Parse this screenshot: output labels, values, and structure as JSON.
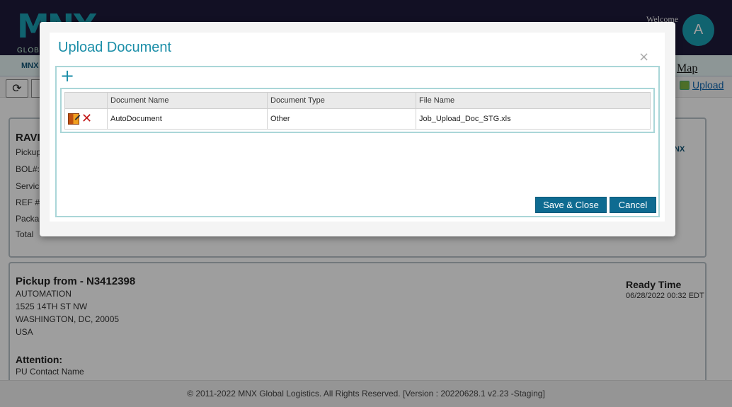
{
  "header": {
    "logo_text": "MNX",
    "logo_sub": "GLOBAL",
    "welcome": "Welcome",
    "avatar_initial": "A"
  },
  "subnav": {
    "brand": "MNX"
  },
  "map_link": "Map",
  "toolbar": {
    "upload_label": "Upload"
  },
  "card1": {
    "title": "RAVI",
    "lines": [
      "Pickup",
      "BOL#:",
      "Servic",
      "REF #:",
      "Packa",
      "Total"
    ],
    "brand": "NX"
  },
  "card2": {
    "title": "Pickup from - N3412398",
    "address": [
      "AUTOMATION",
      "1525 14TH ST NW",
      "WASHINGTON, DC, 20005",
      "USA"
    ],
    "ready_label": "Ready Time",
    "ready_value": "06/28/2022 00:32 EDT",
    "attention_label": "Attention:",
    "contact": "PU Contact Name"
  },
  "footer": "© 2011-2022 MNX Global Logistics. All Rights Reserved. [Version : 20220628.1 v2.23 -Staging]",
  "modal": {
    "title": "Upload Document",
    "close_glyph": "×",
    "add_glyph": "+",
    "columns": [
      "",
      "Document Name",
      "Document Type",
      "File Name"
    ],
    "rows": [
      {
        "name": "AutoDocument",
        "type": "Other",
        "file": "Job_Upload_Doc_STG.xls"
      }
    ],
    "delete_glyph": "✕",
    "save_label": "Save & Close",
    "cancel_label": "Cancel"
  }
}
